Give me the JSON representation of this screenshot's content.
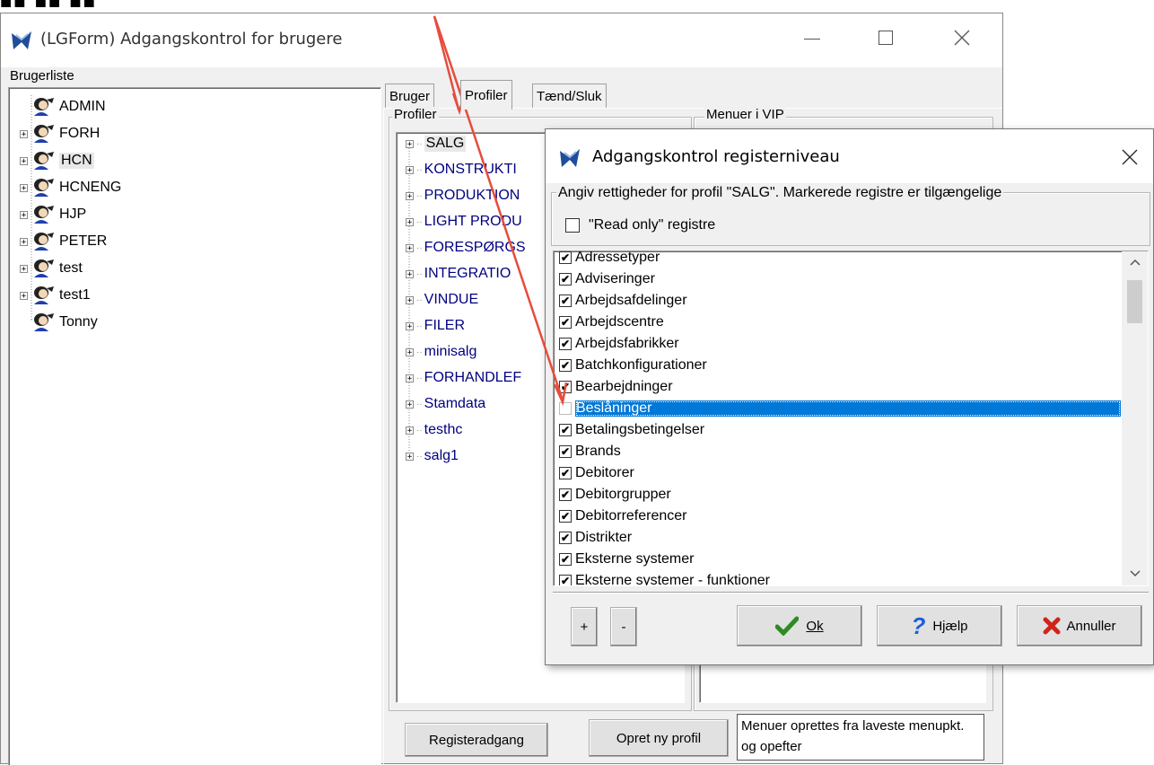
{
  "main_window": {
    "title": "(LGForm) Adgangskontrol for brugere",
    "user_list_label": "Brugerliste",
    "users": [
      "ADMIN",
      "FORH",
      "HCN",
      "HCNENG",
      "HJP",
      "PETER",
      "test",
      "test1",
      "Tonny"
    ],
    "tabs": [
      "Bruger",
      "Profiler",
      "Tænd/Sluk"
    ],
    "profiles_label": "Profiler",
    "menus_label": "Menuer i VIP",
    "profiles": [
      "SALG",
      "KONSTRUKTI",
      "PRODUKTION",
      "LIGHT PRODU",
      "FORESPØRGS",
      "INTEGRATIO",
      "VINDUE",
      "FILER",
      "minisalg",
      "FORHANDLEF",
      "Stamdata",
      "testhc",
      "salg1"
    ],
    "register_access_button": "Registeradgang",
    "new_profile_button": "Opret ny profil",
    "info_text": "Menuer oprettes fra laveste menupkt. og opefter"
  },
  "dialog": {
    "title": "Adgangskontrol registerniveau",
    "instructions": "Angiv rettigheder for profil \"SALG\". Markerede registre er tilgængelige",
    "readonly_label": "\"Read only\" registre",
    "registers": [
      {
        "name": "Adressetyper",
        "checked": true
      },
      {
        "name": "Adviseringer",
        "checked": true
      },
      {
        "name": "Arbejdsafdelinger",
        "checked": true
      },
      {
        "name": "Arbejdscentre",
        "checked": true
      },
      {
        "name": "Arbejdsfabrikker",
        "checked": true
      },
      {
        "name": "Batchkonfigurationer",
        "checked": true
      },
      {
        "name": "Bearbejdninger",
        "checked": true
      },
      {
        "name": "Beslåninger",
        "checked": false,
        "selected": true
      },
      {
        "name": "Betalingsbetingelser",
        "checked": true
      },
      {
        "name": "Brands",
        "checked": true
      },
      {
        "name": "Debitorer",
        "checked": true
      },
      {
        "name": "Debitorgrupper",
        "checked": true
      },
      {
        "name": "Debitorreferencer",
        "checked": true
      },
      {
        "name": "Distrikter",
        "checked": true
      },
      {
        "name": "Eksterne systemer",
        "checked": true
      },
      {
        "name": "Eksterne systemer - funktioner",
        "checked": true
      }
    ],
    "plus_button": "+",
    "minus_button": "-",
    "ok_button": "Ok",
    "help_button": "Hjælp",
    "cancel_button": "Annuller"
  },
  "colors": {
    "selection": "#0078d7",
    "profile_text": "#000080",
    "annotation_arrow": "#e74c3c"
  }
}
